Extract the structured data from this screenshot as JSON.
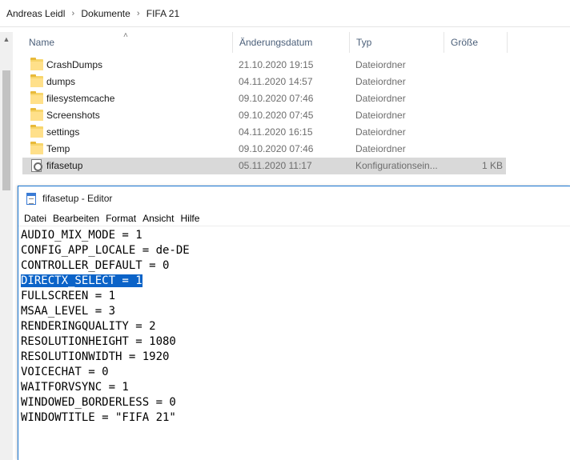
{
  "breadcrumb": [
    "Andreas Leidl",
    "Dokumente",
    "FIFA 21"
  ],
  "columns": {
    "name": "Name",
    "date": "Änderungsdatum",
    "type": "Typ",
    "size": "Größe"
  },
  "files": [
    {
      "name": "CrashDumps",
      "date": "21.10.2020 19:15",
      "type": "Dateiordner",
      "size": "",
      "icon": "folder-icon"
    },
    {
      "name": "dumps",
      "date": "04.11.2020 14:57",
      "type": "Dateiordner",
      "size": "",
      "icon": "folder-icon"
    },
    {
      "name": "filesystemcache",
      "date": "09.10.2020 07:46",
      "type": "Dateiordner",
      "size": "",
      "icon": "folder-icon"
    },
    {
      "name": "Screenshots",
      "date": "09.10.2020 07:45",
      "type": "Dateiordner",
      "size": "",
      "icon": "folder-icon"
    },
    {
      "name": "settings",
      "date": "04.11.2020 16:15",
      "type": "Dateiordner",
      "size": "",
      "icon": "folder-icon"
    },
    {
      "name": "Temp",
      "date": "09.10.2020 07:46",
      "type": "Dateiordner",
      "size": "",
      "icon": "folder-icon"
    },
    {
      "name": "fifasetup",
      "date": "05.11.2020 11:17",
      "type": "Konfigurationsein...",
      "size": "1 KB",
      "icon": "config-file-icon",
      "selected": true
    }
  ],
  "notepad": {
    "title": "fifasetup - Editor",
    "menu": [
      "Datei",
      "Bearbeiten",
      "Format",
      "Ansicht",
      "Hilfe"
    ],
    "lines": [
      "AUDIO_MIX_MODE = 1",
      "CONFIG_APP_LOCALE = de-DE",
      "CONTROLLER_DEFAULT = 0",
      "DIRECTX_SELECT = 1",
      "FULLSCREEN = 1",
      "MSAA_LEVEL = 3",
      "RENDERINGQUALITY = 2",
      "RESOLUTIONHEIGHT = 1080",
      "RESOLUTIONWIDTH = 1920",
      "VOICECHAT = 0",
      "WAITFORVSYNC = 1",
      "WINDOWED_BORDERLESS = 0",
      "WINDOWTITLE = \"FIFA 21\""
    ],
    "selected_line": 3
  },
  "colors": {
    "selection": "#0b63c8",
    "row_selected": "#d9d9d9",
    "header_text": "#4c607a"
  }
}
